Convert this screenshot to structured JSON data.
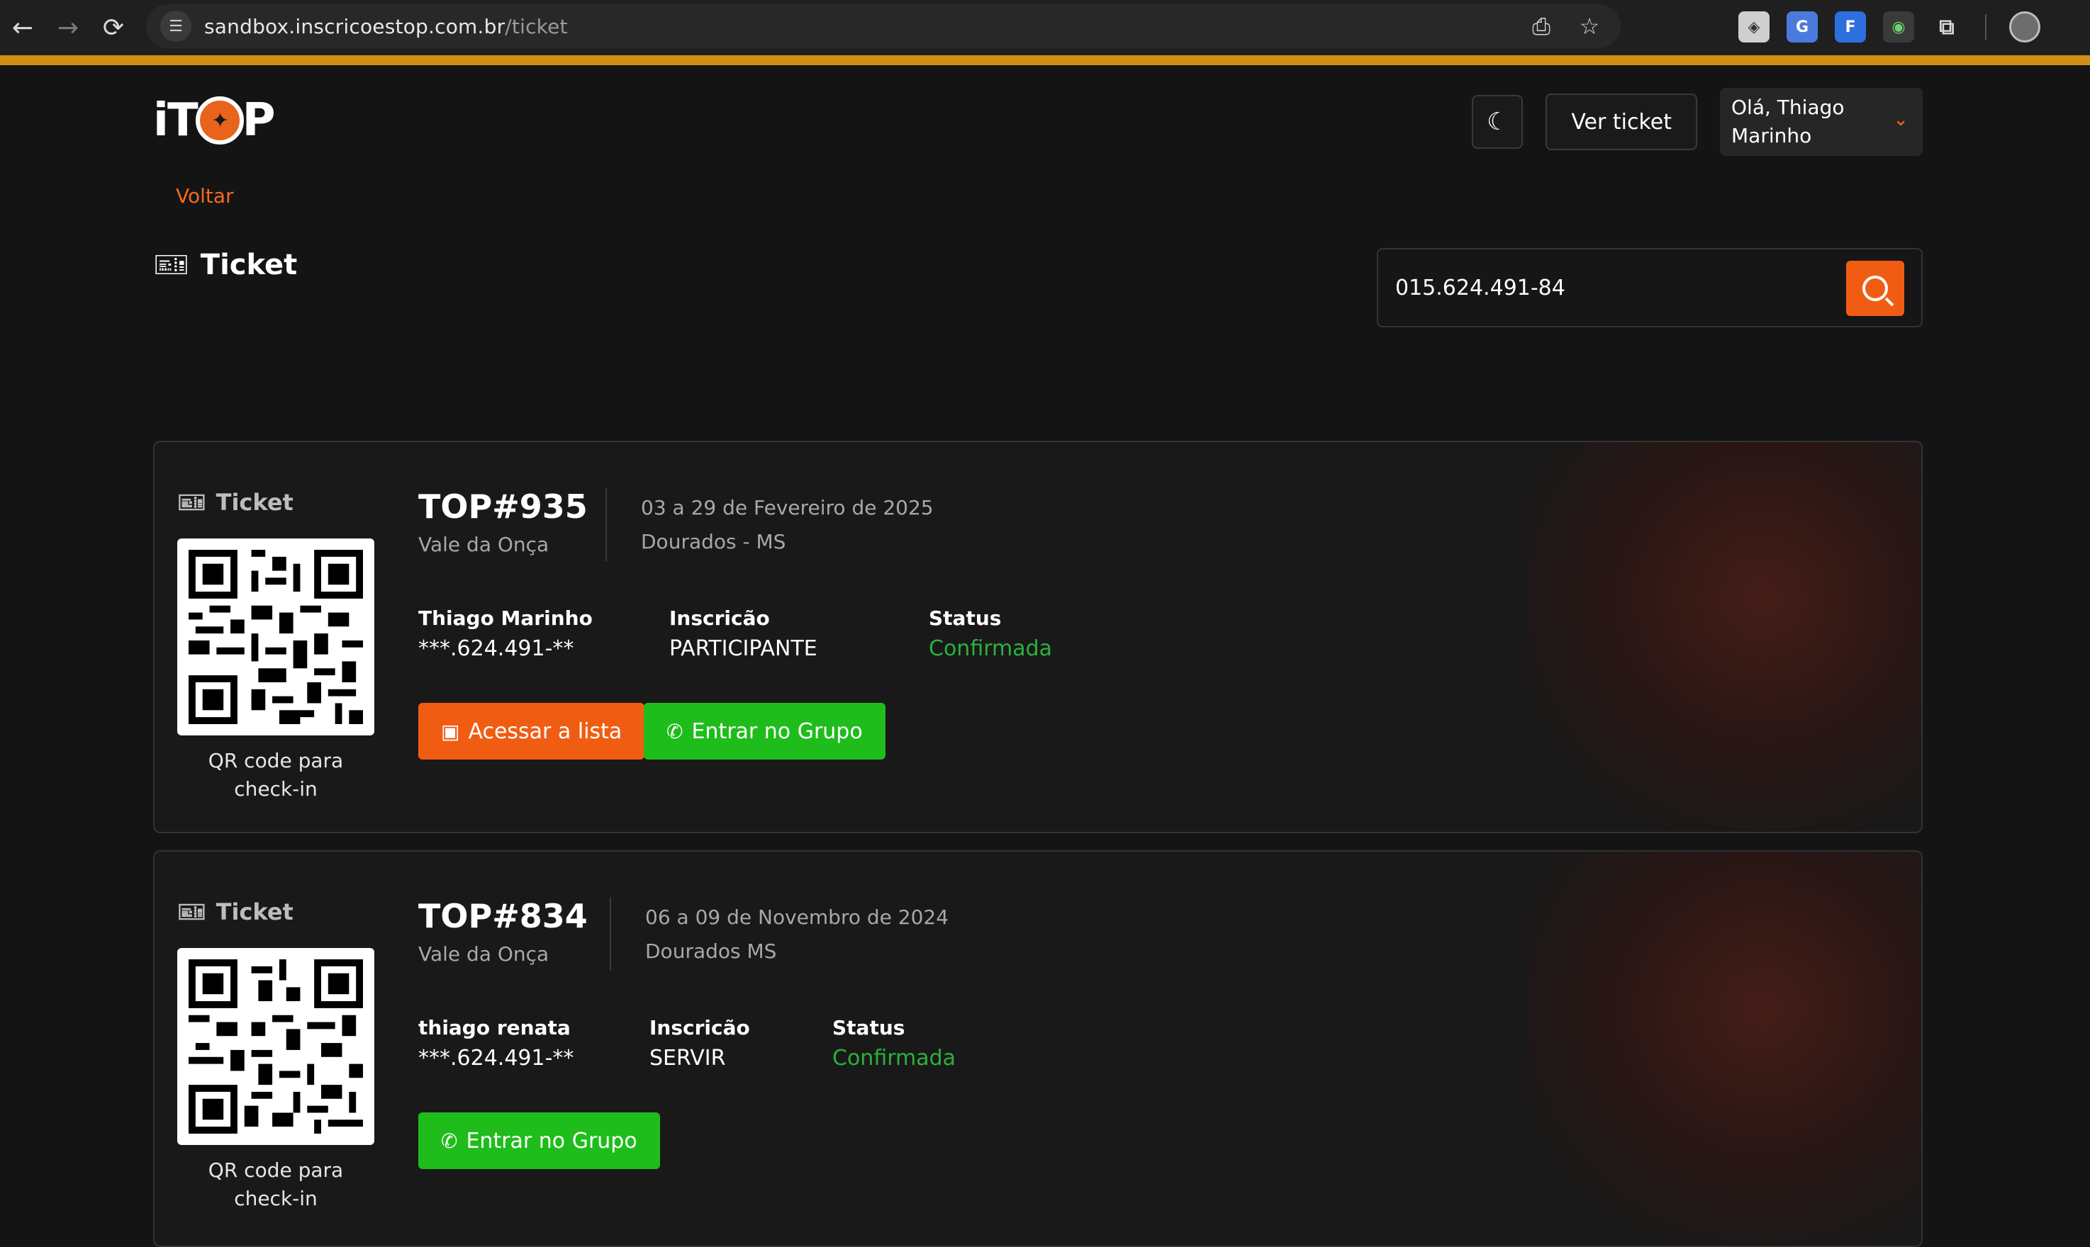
{
  "browser": {
    "url_domain": "sandbox.inscricoestop.com.br",
    "url_path": "/ticket"
  },
  "colors": {
    "accent": "#f05d12",
    "success": "#1fbd1b",
    "status_green": "#2bb13c",
    "top_bar": "#d08f12"
  },
  "header": {
    "logo_prefix": "iT",
    "logo_suffix": "P",
    "view_ticket_label": "Ver ticket",
    "user_greeting": "Olá, Thiago Marinho"
  },
  "nav": {
    "back_label": "Voltar"
  },
  "page": {
    "title": "Ticket"
  },
  "search": {
    "value": "015.624.491-84"
  },
  "tickets": [
    {
      "label": "Ticket",
      "qr_caption": "QR code para check-in",
      "code": "TOP#935",
      "place": "Vale da Onça",
      "dates": "03 a 29 de Fevereiro de 2025",
      "city": "Dourados - MS",
      "name": "Thiago Marinho",
      "document": "***.624.491-**",
      "registration_label": "Inscricão",
      "registration_value": "PARTICIPANTE",
      "status_label": "Status",
      "status_value": "Confirmada",
      "list_button": "Acessar a lista",
      "group_button": "Entrar no Grupo"
    },
    {
      "label": "Ticket",
      "qr_caption": "QR code para check-in",
      "code": "TOP#834",
      "place": "Vale da Onça",
      "dates": "06 a 09 de Novembro de 2024",
      "city": "Dourados MS",
      "name": "thiago renata",
      "document": "***.624.491-**",
      "registration_label": "Inscricão",
      "registration_value": "SERVIR",
      "status_label": "Status",
      "status_value": "Confirmada",
      "group_button": "Entrar no Grupo"
    }
  ]
}
